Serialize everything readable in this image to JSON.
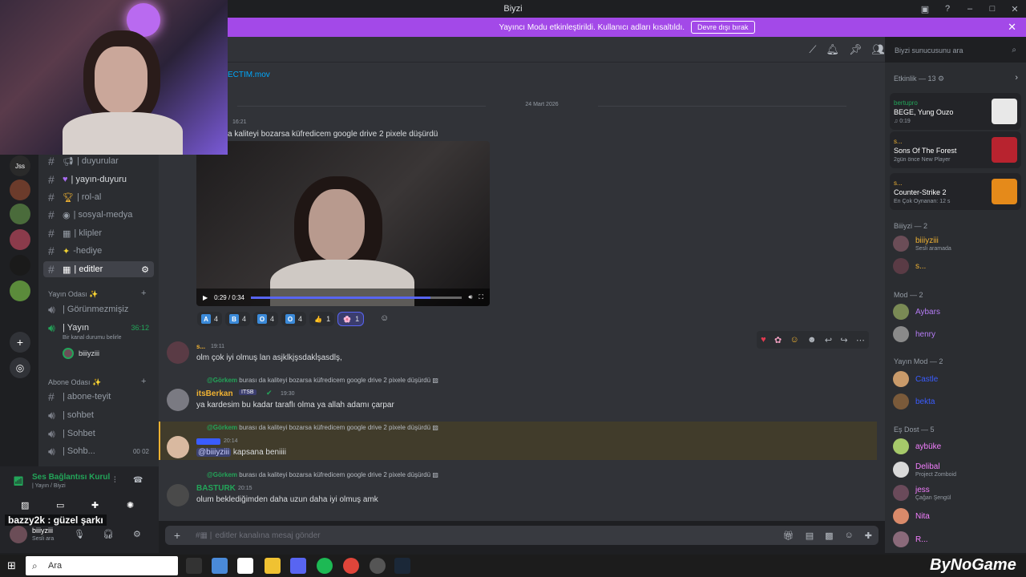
{
  "window": {
    "title": "Biyzi"
  },
  "banner": {
    "text": "Yayıncı Modu etkinleştirildi. Kullanıcı adları kısaltıldı.",
    "button": "Devre dışı bırak"
  },
  "search": {
    "placeholder": "Biyzi sunucusunu ara"
  },
  "sidebar": {
    "channels_top": [
      {
        "label": "| duyurular",
        "icon": "megaphone"
      },
      {
        "label": "| yayın-duyuru",
        "icon": "purple-heart"
      },
      {
        "label": "| rol-al",
        "icon": "trophy"
      },
      {
        "label": "| sosyal-medya",
        "icon": "globe"
      },
      {
        "label": "| klipler",
        "icon": "clapper"
      },
      {
        "label": "-hediye",
        "icon": "sparkles"
      },
      {
        "label": "| editler",
        "icon": "clapper"
      }
    ],
    "cat_yayin": "Yayın Odası ✨",
    "voice_channels": [
      {
        "label": "| Görünmezmişiz"
      },
      {
        "label": "| Yayın",
        "time": "36:12"
      }
    ],
    "voice_status": "Bir kanal durumu belirle",
    "voice_user": "biiiyziii",
    "cat_abone": "Abone Odası ✨",
    "channels_abone": [
      {
        "label": "| abone-teyit"
      },
      {
        "label": "| sohbet"
      },
      {
        "label": "| Sohbet"
      },
      {
        "label": "| Sohb...",
        "count1": "00",
        "count2": "02"
      }
    ],
    "connection": "Ses Bağlantısı Kurul",
    "connection_sub": "| Yayın / Biyzi",
    "user_name": "biiiyziii",
    "user_status": "Sesli ara"
  },
  "caption": "bazzy2k : güzel şarkı",
  "chat": {
    "attachment": "ECTIM.mov",
    "date_divider": "24 Mart 2026",
    "msg1_time": "16:21",
    "msg1_text": "a kaliteyi bozarsa küfredicem google drive 2 pixele düşürdü",
    "video_time": "0:29 / 0:34",
    "video_progress": 0.85,
    "reactions": [
      {
        "emoji": "A",
        "count": "4",
        "color": "#3b8ad9"
      },
      {
        "emoji": "B",
        "count": "4",
        "color": "#3b8ad9"
      },
      {
        "emoji": "O",
        "count": "4",
        "color": "#3b8ad9"
      },
      {
        "emoji": "O",
        "count": "4",
        "color": "#3b8ad9"
      },
      {
        "emoji": "👍",
        "count": "1",
        "color": "transparent"
      },
      {
        "emoji": "🌸",
        "count": "1",
        "color": "transparent",
        "active": true
      }
    ],
    "msg2_name": "s...",
    "msg2_time": "19:11",
    "msg2_text": "olm çok iyi olmuş lan asjklkjşsdakl̇şasdlş,",
    "reply_user": "@Görkem",
    "reply_text": "burası da kaliteyi bozarsa küfredicem google drive 2 pixele düşürdü",
    "msg3_name": "itsBerkan",
    "msg3_tag": "ITSB",
    "msg3_time": "19:30",
    "msg3_text": "ya kardesim bu kadar taraflı olma ya allah adamı çarpar",
    "msg4_time": "20:14",
    "msg4_mention": "@biiiyziii",
    "msg4_text": "kapsana beniiii",
    "msg5_name": "BASTURK",
    "msg5_time": "20:15",
    "msg5_text": "olum beklediğimden daha uzun daha iyi olmuş amk",
    "composer_placeholder": "editler kanalına mesaj gönder"
  },
  "members": {
    "activity_header": "Etkinlik — 13",
    "activities": [
      {
        "user": "bertupro",
        "title": "BEGE, Yung Ouzo",
        "sub": "♫ 0:19",
        "thumb": "#e8e8e8",
        "user_color": "#23a559"
      },
      {
        "user": "s...",
        "title": "Sons Of The Forest",
        "sub": "2gün önce   New Player",
        "thumb": "#b8232f",
        "user_color": "#f0b232"
      },
      {
        "user": "s...",
        "title": "Counter-Strike 2",
        "sub": "En Çok Oynanan: 12 s",
        "thumb": "#e58a1a",
        "user_color": "#f0b232"
      }
    ],
    "group_biiiyzi": "Biiiyzi — 2",
    "biiiyzi": [
      {
        "name": "biiiyziii",
        "sub": "Sesli aramada",
        "color": "#f0b232",
        "av": "#6b4d57"
      },
      {
        "name": "s...",
        "sub": "",
        "color": "#f0b232",
        "av": "#5a3b45"
      }
    ],
    "group_mod": "Mod — 2",
    "mods": [
      {
        "name": "Aybars",
        "color": "#b57cf5",
        "av": "#7a8a55"
      },
      {
        "name": "henry",
        "color": "#b57cf5",
        "av": "#8a8a8a"
      }
    ],
    "group_yayin_mod": "Yayın Mod — 2",
    "yayin_mods": [
      {
        "name": "Castle",
        "color": "#3a5cff",
        "av": "#c99a6a"
      },
      {
        "name": "bekta",
        "color": "#3a5cff",
        "av": "#7a5a3a"
      }
    ],
    "group_esdost": "Eş Dost — 5",
    "esdost": [
      {
        "name": "aybüke",
        "sub": "",
        "color": "#f47fff",
        "av": "#a6c96a"
      },
      {
        "name": "Delibal",
        "sub": "Project Zomboid",
        "color": "#f47fff",
        "av": "#d9d9d9"
      },
      {
        "name": "jess",
        "sub": "Çağan Şengül",
        "color": "#f47fff",
        "av": "#6a4a5a"
      },
      {
        "name": "Nita",
        "sub": "",
        "color": "#f47fff",
        "av": "#d98a6a"
      },
      {
        "name": "R...",
        "sub": "",
        "color": "#f47fff",
        "av": "#8a6a7a"
      }
    ]
  },
  "taskbar": {
    "search": "Ara"
  },
  "watermark": "ByNoGame"
}
